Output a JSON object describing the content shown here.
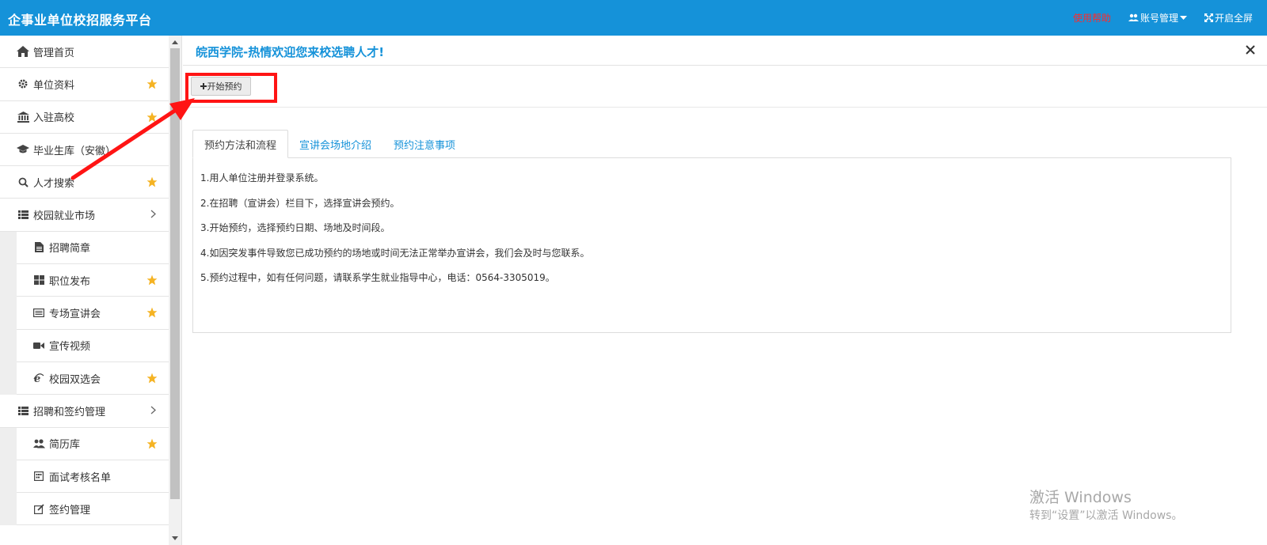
{
  "header": {
    "brand": "企事业单位校招服务平台",
    "help": "使用帮助",
    "account": "账号管理",
    "fullscreen": "开启全屏"
  },
  "sidebar": {
    "items": [
      {
        "label": "管理首页",
        "icon": "home-icon",
        "star": false
      },
      {
        "label": "单位资料",
        "icon": "gear-icon",
        "star": true
      },
      {
        "label": "入驻高校",
        "icon": "bank-icon",
        "star": true
      },
      {
        "label": "毕业生库（安徽）",
        "icon": "graduation-cap-icon",
        "star": false
      },
      {
        "label": "人才搜索",
        "icon": "search-icon",
        "star": true
      },
      {
        "label": "校园就业市场",
        "icon": "list-icon",
        "expandable": true
      },
      {
        "label": "招聘简章",
        "icon": "file-icon",
        "star": false,
        "sub": true
      },
      {
        "label": "职位发布",
        "icon": "grid-icon",
        "star": true,
        "sub": true
      },
      {
        "label": "专场宣讲会",
        "icon": "card-icon",
        "star": true,
        "sub": true
      },
      {
        "label": "宣传视频",
        "icon": "video-icon",
        "star": false,
        "sub": true
      },
      {
        "label": "校园双选会",
        "icon": "ie-icon",
        "star": true,
        "sub": true
      },
      {
        "label": "招聘和签约管理",
        "icon": "list-icon",
        "expandable": true
      },
      {
        "label": "简历库",
        "icon": "users-icon",
        "star": true,
        "sub": true
      },
      {
        "label": "面试考核名单",
        "icon": "calendar-icon",
        "star": false,
        "sub": true
      },
      {
        "label": "签约管理",
        "icon": "edit-icon",
        "star": false,
        "sub": true
      }
    ]
  },
  "main": {
    "title": "皖西学院-热情欢迎您来校选聘人才!",
    "start_button": "开始预约",
    "tabs": [
      "预约方法和流程",
      "宣讲会场地介绍",
      "预约注意事项"
    ],
    "lines": [
      "1.用人单位注册并登录系统。",
      "2.在招聘（宣讲会）栏目下，选择宣讲会预约。",
      "3.开始预约，选择预约日期、场地及时间段。",
      "4.如因突发事件导致您已成功预约的场地或时间无法正常举办宣讲会，我们会及时与您联系。",
      "5.预约过程中，如有任何问题，请联系学生就业指导中心，电话：0564-3305019。"
    ]
  },
  "watermark": {
    "line1": "激活 Windows",
    "line2": "转到“设置”以激活 Windows。"
  },
  "colors": {
    "primary": "#1592d9",
    "help": "#ff2a2a",
    "star": "#f5b323",
    "annotation": "#ff1414"
  }
}
